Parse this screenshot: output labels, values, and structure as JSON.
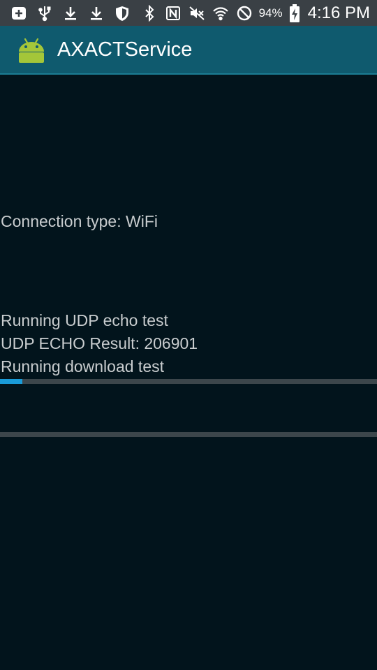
{
  "status_bar": {
    "icons_left": [
      "add-box-icon",
      "usb-icon",
      "download-icon",
      "download-icon",
      "shield-icon"
    ],
    "icons_right": [
      "bluetooth-icon",
      "nfc-icon",
      "mute-icon",
      "wifi-icon",
      "block-icon",
      "battery-charging-icon"
    ],
    "battery_percent": "94%",
    "time": "4:16 PM"
  },
  "action_bar": {
    "title": "AXACTService"
  },
  "main": {
    "connection_type": "Connection type: WiFi",
    "log_lines": [
      "Running UDP echo test",
      "UDP ECHO Result: 206901",
      "Running download test"
    ],
    "download_progress": 0.06,
    "secondary_progress": 0
  },
  "colors": {
    "status_bar_bg": "#3a4045",
    "action_bar_bg": "#0f5a6e",
    "content_bg": "#02141c",
    "progress_accent": "#1a9bd8",
    "text": "#c9cdcf"
  }
}
